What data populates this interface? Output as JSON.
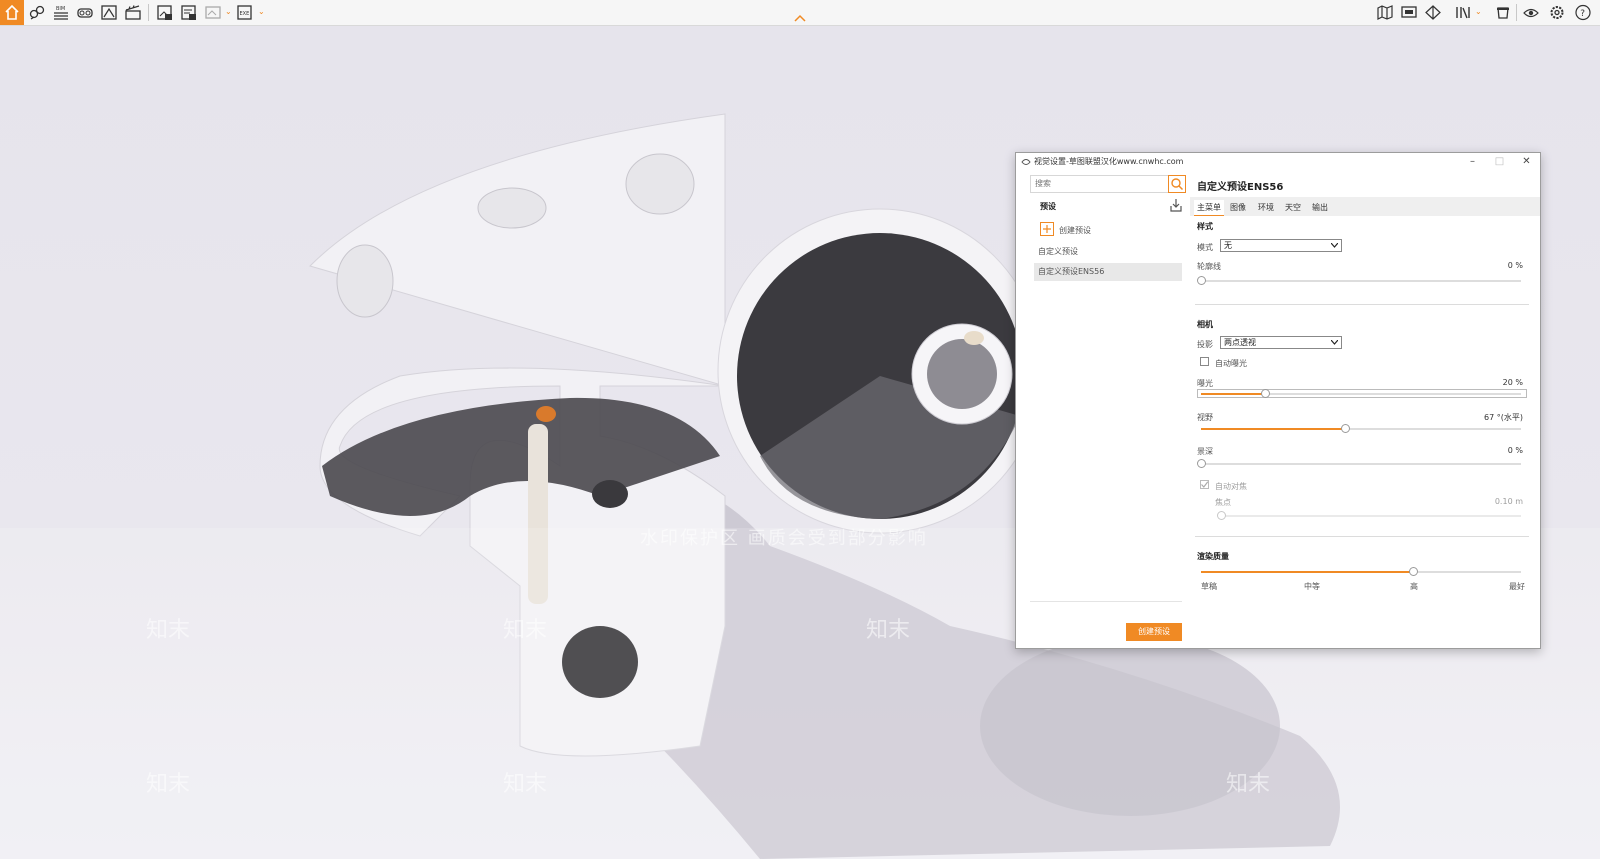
{
  "toolbar": {
    "accent": "#f08a24",
    "icons_left": [
      "home-icon",
      "binoculars-link-icon",
      "bim-icon",
      "vr-goggles-icon",
      "scene-icon",
      "clapper-icon",
      "export-image-icon",
      "export-image2-icon",
      "export-panorama-icon",
      "export-exe-icon"
    ],
    "bim_label": "BIM",
    "exe_label": "EXE",
    "icons_right": [
      "map-icon",
      "monitor-icon",
      "half-sphere-icon",
      "books-icon",
      "cup-icon",
      "eye-icon",
      "gear-icon",
      "help-icon"
    ]
  },
  "viewport": {
    "watermark_band_text": "水印保护区  画质会受到部分影响",
    "watermark_logo": "知末"
  },
  "panel": {
    "title": "视觉设置-草图联盟汉化www.cnwhc.com",
    "search_placeholder": "搜索",
    "presets_heading": "预设",
    "create_preset_link": "创建预设",
    "presets": [
      "自定义预设",
      "自定义预设ENS56"
    ],
    "create_preset_button": "创建预设",
    "selected_title": "自定义预设ENS56",
    "tabs": [
      "主菜单",
      "图像",
      "环境",
      "天空",
      "输出"
    ],
    "style": {
      "heading": "样式",
      "mode_label": "模式",
      "mode_value": "无",
      "outline_label": "轮廓线",
      "outline_value": "0 %",
      "outline_level": 0
    },
    "camera": {
      "heading": "相机",
      "projection_label": "投影",
      "projection_value": "两点透视",
      "auto_exposure_label": "自动曝光",
      "exposure_label": "曝光",
      "exposure_value": "20 %",
      "exposure_level": 0.2,
      "fov_label": "视野",
      "fov_value": "67 °(水平)",
      "fov_level": 0.45,
      "dof_label": "景深",
      "dof_value": "0 %",
      "dof_level": 0,
      "auto_focus_label": "自动对焦",
      "focus_label": "焦点",
      "focus_value": "0.10 m",
      "focus_level": 0
    },
    "quality": {
      "heading": "渲染质量",
      "levels": [
        "草稿",
        "中等",
        "高",
        "最好"
      ],
      "level": 0.66
    }
  }
}
